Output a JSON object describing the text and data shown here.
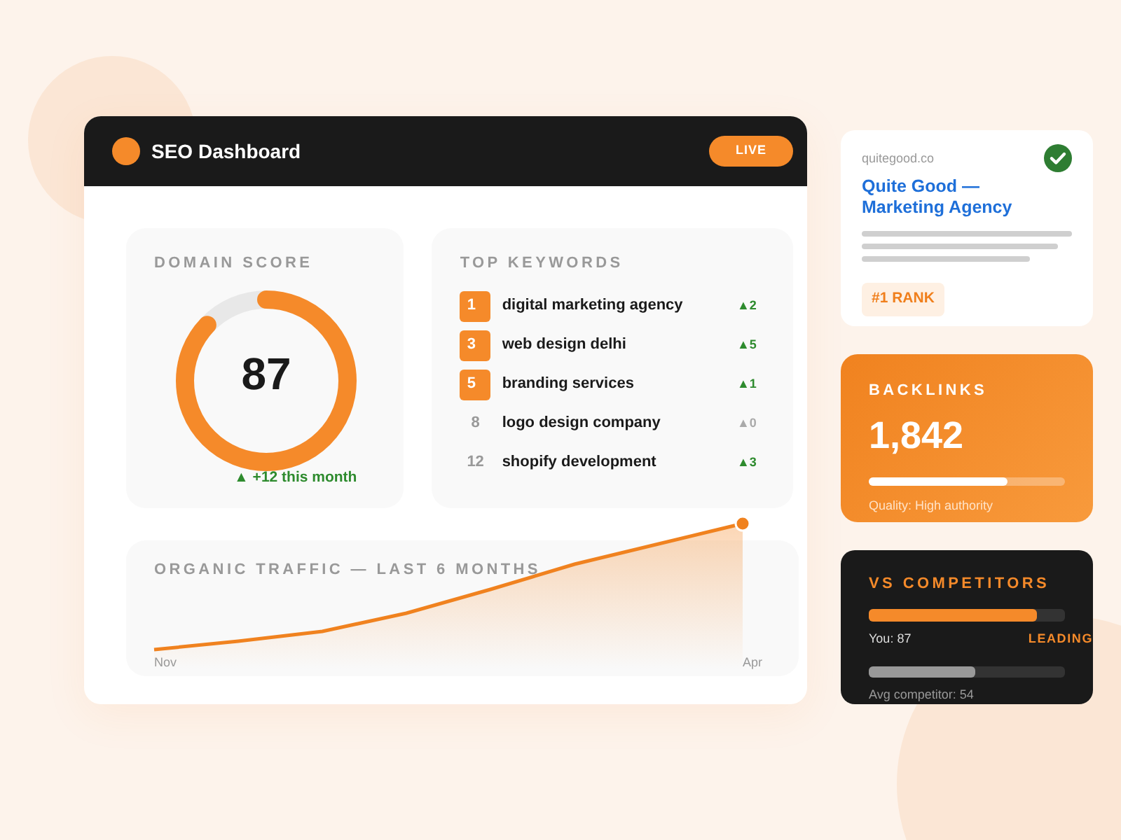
{
  "dashboard": {
    "title": "SEO Dashboard",
    "status": "LIVE"
  },
  "domain_score": {
    "label": "DOMAIN SCORE",
    "score": "87",
    "level": 0.87,
    "change": "▲ +12 this month"
  },
  "top_keywords": {
    "label": "TOP KEYWORDS",
    "items": [
      {
        "rank": "1",
        "keyword": "digital marketing agency",
        "change": "▲2",
        "highlighted": true,
        "kind": "up"
      },
      {
        "rank": "3",
        "keyword": "web design delhi",
        "change": "▲5",
        "highlighted": true,
        "kind": "up"
      },
      {
        "rank": "5",
        "keyword": "branding services",
        "change": "▲1",
        "highlighted": true,
        "kind": "up"
      },
      {
        "rank": "8",
        "keyword": "logo design company",
        "change": "▲0",
        "highlighted": false,
        "kind": "flat"
      },
      {
        "rank": "12",
        "keyword": "shopify development",
        "change": "▲3",
        "highlighted": false,
        "kind": "up"
      }
    ]
  },
  "organic_traffic": {
    "label": "ORGANIC TRAFFIC — LAST 6 MONTHS",
    "start": "Nov",
    "end": "Apr"
  },
  "search_result": {
    "domain": "quitegood.co",
    "title": "Quite Good — Marketing Agency",
    "verified": true,
    "badge": "#1 RANK"
  },
  "backlinks": {
    "label": "BACKLINKS",
    "value": "1,842",
    "level": 0.71,
    "note": "Quality: High authority"
  },
  "competitors": {
    "label": "VS COMPETITORS",
    "you": {
      "text": "You: 87",
      "level": 0.86,
      "tag": "LEADING"
    },
    "avg": {
      "text": "Avg competitor: 54",
      "level": 0.54
    }
  }
}
